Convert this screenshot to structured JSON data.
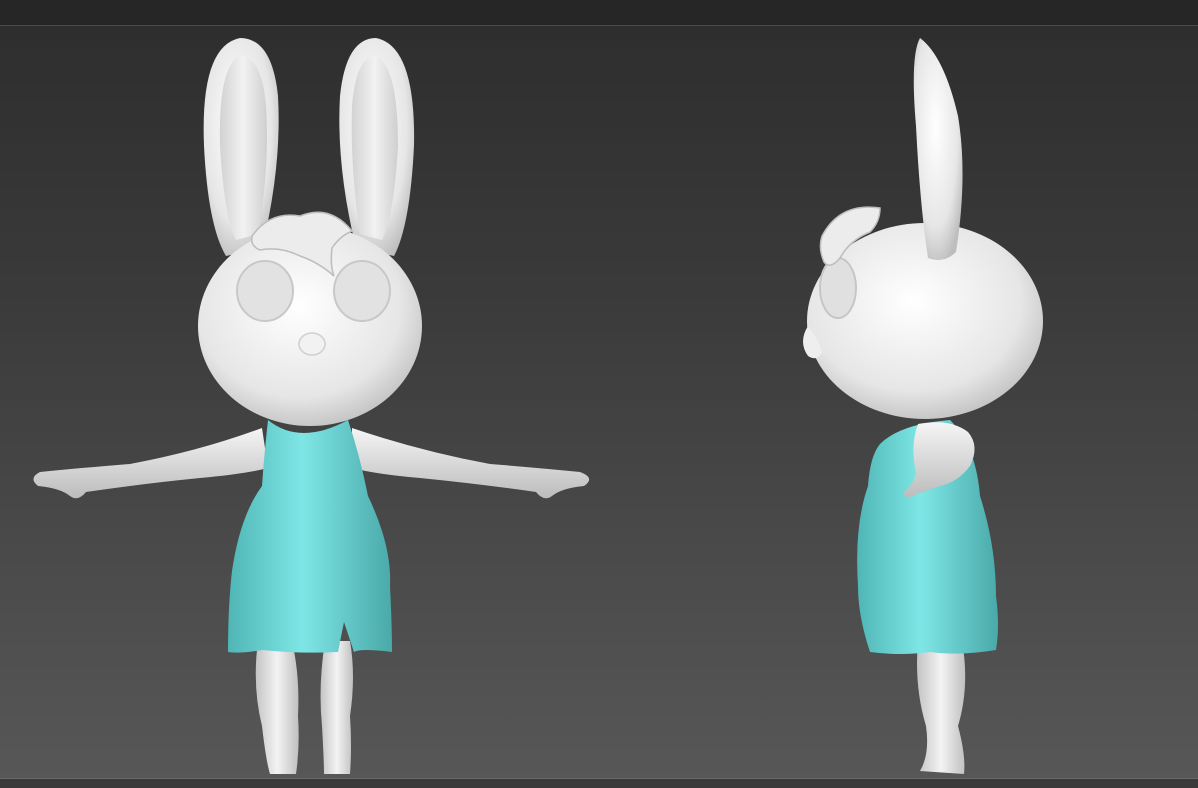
{
  "window": {
    "title": ""
  },
  "colors": {
    "background_top": "#2e2e2e",
    "background_bottom": "#575757",
    "model_body": "#e6e6e6",
    "model_dress": "#6fd6d6"
  },
  "viewport": {
    "views": [
      {
        "name": "front-view"
      },
      {
        "name": "side-view"
      }
    ]
  }
}
